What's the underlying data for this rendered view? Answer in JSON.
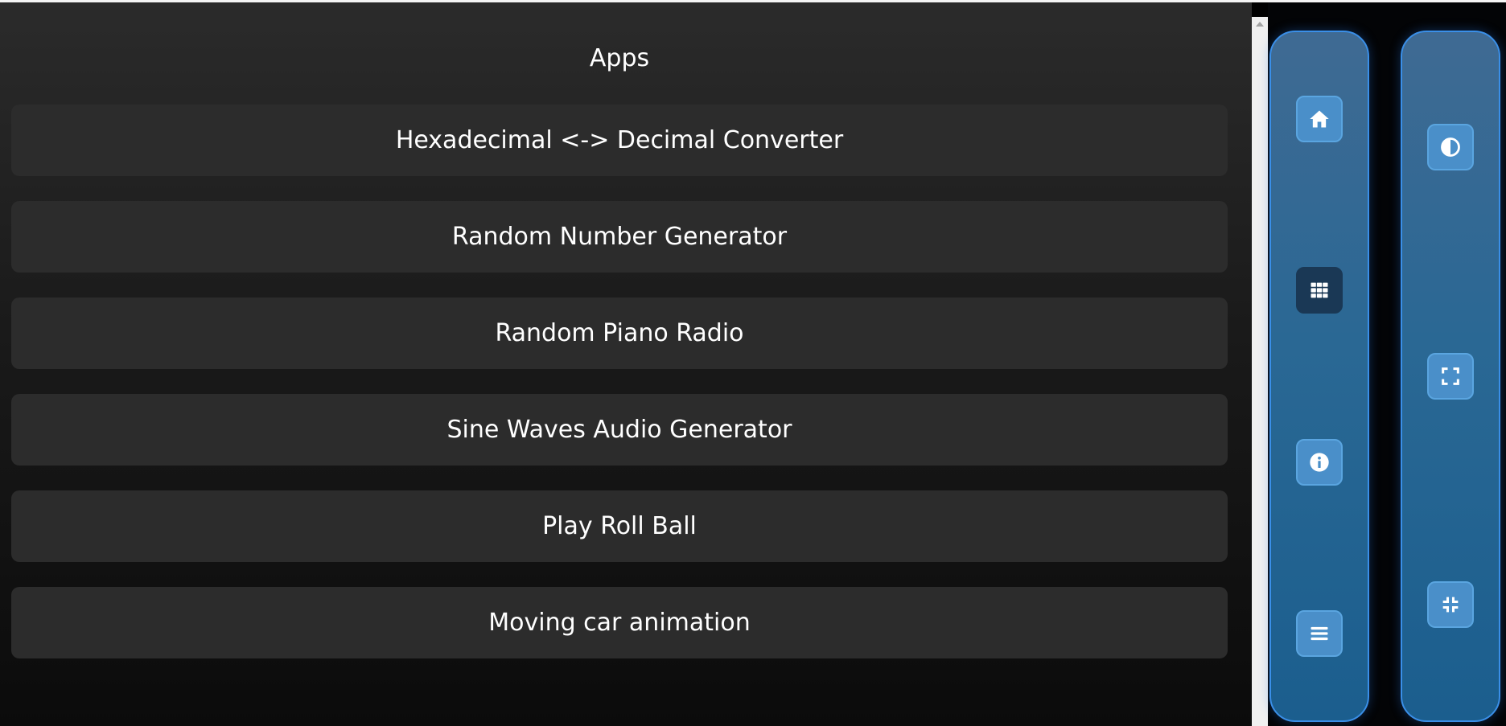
{
  "page": {
    "title": "Apps"
  },
  "apps": [
    {
      "label": "Hexadecimal <-> Decimal Converter"
    },
    {
      "label": "Random Number Generator"
    },
    {
      "label": "Random Piano Radio"
    },
    {
      "label": "Sine Waves Audio Generator"
    },
    {
      "label": "Play Roll Ball"
    },
    {
      "label": "Moving car animation"
    }
  ],
  "nav_panel": {
    "buttons": [
      {
        "icon": "home-icon",
        "active": false
      },
      {
        "icon": "grid-icon",
        "active": true
      },
      {
        "icon": "info-icon",
        "active": false
      },
      {
        "icon": "menu-icon",
        "active": false
      }
    ]
  },
  "tools_panel": {
    "buttons": [
      {
        "icon": "contrast-icon"
      },
      {
        "icon": "expand-icon"
      },
      {
        "icon": "compress-icon"
      }
    ]
  },
  "colors": {
    "panel_border": "#3a8fe8",
    "button": "#4a8fc9",
    "button_active": "#1a3855",
    "app_item": "#2c2c2c"
  }
}
